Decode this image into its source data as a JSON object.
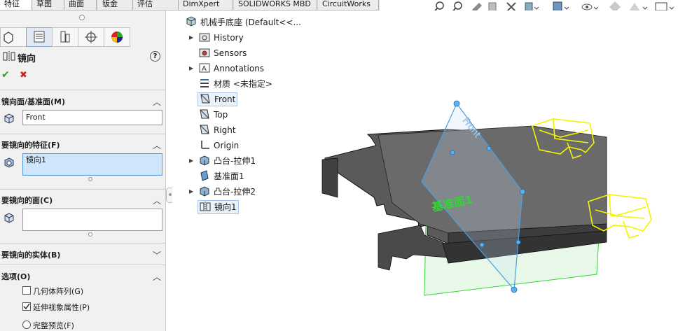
{
  "tabs": [
    "特征",
    "草图",
    "曲面",
    "钣金",
    "评估",
    "DimXpert",
    "SOLIDWORKS MBD",
    "CircuitWorks"
  ],
  "panel": {
    "feature_title": "镜向",
    "help_icon": "?",
    "confirm_icon": "✔",
    "cancel_icon": "✖",
    "sections": {
      "mirror_plane": {
        "label": "镜向面/基准面(M)",
        "value": "Front"
      },
      "features": {
        "label": "要镜向的特征(F)",
        "value": "镜向1"
      },
      "faces": {
        "label": "要镜向的面(C)",
        "value": ""
      },
      "bodies": {
        "label": "要镜向的实体(B)"
      },
      "options": {
        "label": "选项(O)",
        "items": [
          {
            "label": "几何体阵列(G)",
            "type": "checkbox",
            "checked": false
          },
          {
            "label": "延伸视象属性(P)",
            "type": "checkbox",
            "checked": true
          },
          {
            "label": "完整预览(F)",
            "type": "radio",
            "checked": false
          }
        ]
      }
    }
  },
  "tree": {
    "root": "机械手底座  (Default<<...",
    "items": [
      {
        "label": "History",
        "icon": "history-folder-icon",
        "expandable": true
      },
      {
        "label": "Sensors",
        "icon": "sensors-icon",
        "expandable": false
      },
      {
        "label": "Annotations",
        "icon": "annotations-icon",
        "expandable": true
      },
      {
        "label": "材质 <未指定>",
        "icon": "material-icon",
        "expandable": false
      },
      {
        "label": "Front",
        "icon": "plane-icon",
        "expandable": false,
        "highlight": true
      },
      {
        "label": "Top",
        "icon": "plane-icon",
        "expandable": false
      },
      {
        "label": "Right",
        "icon": "plane-icon",
        "expandable": false
      },
      {
        "label": "Origin",
        "icon": "origin-icon",
        "expandable": false
      },
      {
        "label": "凸台-拉伸1",
        "icon": "extrude-icon",
        "expandable": true
      },
      {
        "label": "基准面1",
        "icon": "plane-icon",
        "expandable": false
      },
      {
        "label": "凸台-拉伸2",
        "icon": "extrude-icon",
        "expandable": true
      },
      {
        "label": "镜向1",
        "icon": "mirror-icon",
        "expandable": false,
        "selected": true
      }
    ]
  },
  "viewport": {
    "front_plane_label": "Front",
    "plane1_label": "基准面1",
    "colors": {
      "plane1": "#33d633",
      "front_plane": "#4c9fe0",
      "preview": "#f4f400",
      "body": "#4a4a4a"
    }
  }
}
